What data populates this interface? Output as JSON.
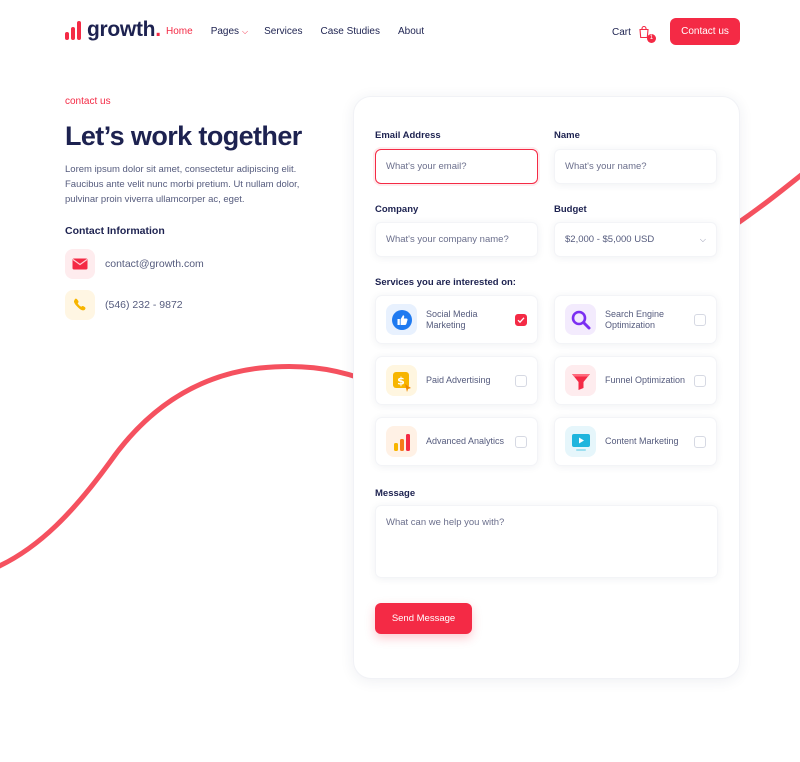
{
  "brand": {
    "name": "growth",
    "dot": ".",
    "accent": "#f42a45",
    "text_color": "#1d2250"
  },
  "nav": {
    "items": [
      {
        "label": "Home",
        "active": true
      },
      {
        "label": "Pages",
        "has_dropdown": true
      },
      {
        "label": "Services"
      },
      {
        "label": "Case Studies"
      },
      {
        "label": "About"
      }
    ],
    "cart_label": "Cart",
    "cart_count": "1",
    "contact_label": "Contact us"
  },
  "hero": {
    "eyebrow": "contact us",
    "title": "Let’s work together",
    "description": "Lorem ipsum dolor sit amet, consectetur adipiscing elit. Faucibus ante velit nunc morbi pretium. Ut nullam dolor, pulvinar proin viverra ullamcorper ac, eget.",
    "contact_title": "Contact Information",
    "email": "contact@growth.com",
    "phone": "(546) 232 - 9872"
  },
  "form": {
    "email": {
      "label": "Email Address",
      "placeholder": "What's your email?"
    },
    "name": {
      "label": "Name",
      "placeholder": "What's your name?"
    },
    "company": {
      "label": "Company",
      "placeholder": "What's your company name?"
    },
    "budget": {
      "label": "Budget",
      "value": "$2,000 - $5,000 USD"
    },
    "services_label": "Services you are interested on:",
    "services": [
      {
        "label": "Social Media Marketing",
        "icon": "thumbs-up-icon",
        "checked": true
      },
      {
        "label": "Search Engine Optimization",
        "icon": "magnifier-icon",
        "checked": false
      },
      {
        "label": "Paid Advertising",
        "icon": "dollar-coin-icon",
        "checked": false
      },
      {
        "label": "Funnel Optimization",
        "icon": "funnel-icon",
        "checked": false
      },
      {
        "label": "Advanced Analytics",
        "icon": "bar-chart-icon",
        "checked": false
      },
      {
        "label": "Content Marketing",
        "icon": "video-screen-icon",
        "checked": false
      }
    ],
    "message": {
      "label": "Message",
      "placeholder": "What can we help you with?"
    },
    "submit_label": "Send Message"
  }
}
